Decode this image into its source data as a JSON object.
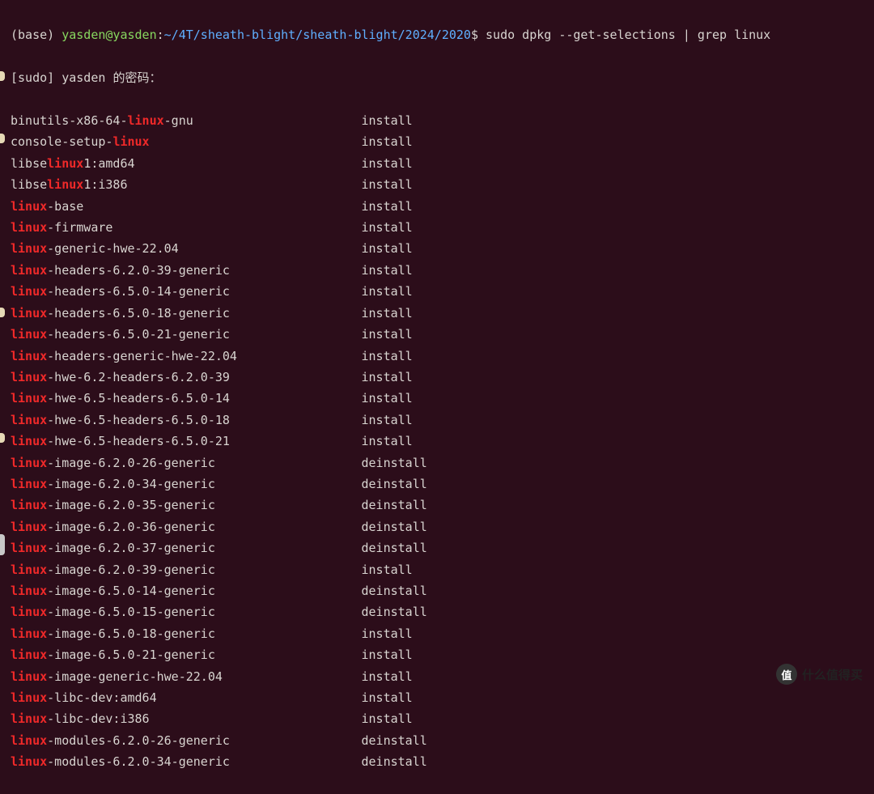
{
  "prompt": {
    "env": "(base) ",
    "user_host": "yasden@yasden",
    "colon": ":",
    "path": "~/4T/sheath-blight/sheath-blight/2024/2020",
    "dollar": "$ ",
    "command_full": "sudo dpkg --get-selections | grep linux",
    "cmd_before": "sudo dpkg --get-selections | grep ",
    "cmd_hl": "linux"
  },
  "sudo_line": {
    "prefix": "[sudo] yasden ",
    "cn": "的密码：",
    "cursor": true
  },
  "status_col": 48,
  "highlight": "linux",
  "packages": [
    {
      "name": "binutils-x86-64-linux-gnu",
      "status": "install"
    },
    {
      "name": "console-setup-linux",
      "status": "install"
    },
    {
      "name": "libselinux1:amd64",
      "status": "install"
    },
    {
      "name": "libselinux1:i386",
      "status": "install"
    },
    {
      "name": "linux-base",
      "status": "install"
    },
    {
      "name": "linux-firmware",
      "status": "install"
    },
    {
      "name": "linux-generic-hwe-22.04",
      "status": "install"
    },
    {
      "name": "linux-headers-6.2.0-39-generic",
      "status": "install"
    },
    {
      "name": "linux-headers-6.5.0-14-generic",
      "status": "install"
    },
    {
      "name": "linux-headers-6.5.0-18-generic",
      "status": "install"
    },
    {
      "name": "linux-headers-6.5.0-21-generic",
      "status": "install"
    },
    {
      "name": "linux-headers-generic-hwe-22.04",
      "status": "install"
    },
    {
      "name": "linux-hwe-6.2-headers-6.2.0-39",
      "status": "install"
    },
    {
      "name": "linux-hwe-6.5-headers-6.5.0-14",
      "status": "install"
    },
    {
      "name": "linux-hwe-6.5-headers-6.5.0-18",
      "status": "install"
    },
    {
      "name": "linux-hwe-6.5-headers-6.5.0-21",
      "status": "install"
    },
    {
      "name": "linux-image-6.2.0-26-generic",
      "status": "deinstall"
    },
    {
      "name": "linux-image-6.2.0-34-generic",
      "status": "deinstall"
    },
    {
      "name": "linux-image-6.2.0-35-generic",
      "status": "deinstall"
    },
    {
      "name": "linux-image-6.2.0-36-generic",
      "status": "deinstall"
    },
    {
      "name": "linux-image-6.2.0-37-generic",
      "status": "deinstall"
    },
    {
      "name": "linux-image-6.2.0-39-generic",
      "status": "install"
    },
    {
      "name": "linux-image-6.5.0-14-generic",
      "status": "deinstall"
    },
    {
      "name": "linux-image-6.5.0-15-generic",
      "status": "deinstall"
    },
    {
      "name": "linux-image-6.5.0-18-generic",
      "status": "install"
    },
    {
      "name": "linux-image-6.5.0-21-generic",
      "status": "install"
    },
    {
      "name": "linux-image-generic-hwe-22.04",
      "status": "install"
    },
    {
      "name": "linux-libc-dev:amd64",
      "status": "install"
    },
    {
      "name": "linux-libc-dev:i386",
      "status": "install"
    },
    {
      "name": "linux-modules-6.2.0-26-generic",
      "status": "deinstall"
    },
    {
      "name": "linux-modules-6.2.0-34-generic",
      "status": "deinstall"
    }
  ],
  "watermark": {
    "badge": "值",
    "text": "什么值得买"
  }
}
